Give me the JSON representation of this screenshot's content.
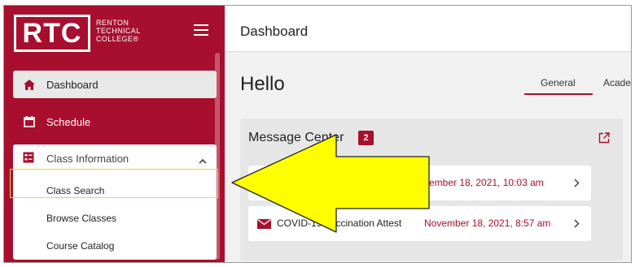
{
  "sidebar": {
    "logo_text": "RTC",
    "college_lines": [
      "RENTON",
      "TECHNICAL",
      "COLLEGE®"
    ],
    "nav": {
      "dashboard": "Dashboard",
      "schedule": "Schedule",
      "class_information": "Class Information"
    },
    "sub_items": [
      "Class Search",
      "Browse Classes",
      "Course Catalog"
    ]
  },
  "header": {
    "title": "Dashboard"
  },
  "main": {
    "greeting": "Hello",
    "tabs": [
      "General",
      "Acade"
    ],
    "message_center": {
      "title": "Message Center",
      "count": "2",
      "messages": [
        {
          "subject": "",
          "date": "vember 18, 2021, 10:03 am"
        },
        {
          "subject": "COVID-19 Vaccination Attest",
          "date": "November 18, 2021, 8:57 am"
        }
      ]
    }
  },
  "colors": {
    "brand": "#a80f2e",
    "highlight": "#ffff00",
    "highlight_outline": "#e3dc3a"
  },
  "icons": [
    "hamburger-icon",
    "home-icon",
    "calendar-icon",
    "list-icon",
    "chevron-up-icon",
    "open-in-new-icon",
    "mail-icon",
    "chevron-right-icon"
  ]
}
